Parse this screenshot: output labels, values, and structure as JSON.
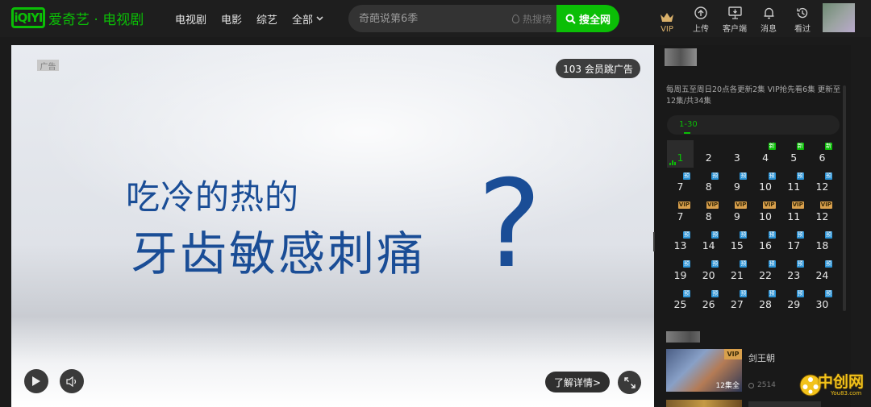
{
  "header": {
    "logo_mark": "iQIYI",
    "logo_text": "爱奇艺 · 电视剧",
    "nav": [
      {
        "label": "电视剧"
      },
      {
        "label": "电影"
      },
      {
        "label": "综艺"
      },
      {
        "label": "全部"
      }
    ],
    "search": {
      "placeholder": "奇葩说第6季",
      "hot_label": "热搜榜",
      "button_label": "搜全网"
    },
    "tools": [
      {
        "label": "VIP",
        "icon": "crown-icon"
      },
      {
        "label": "上传",
        "icon": "upload-icon"
      },
      {
        "label": "客户端",
        "icon": "desktop-icon"
      },
      {
        "label": "消息",
        "icon": "bell-icon"
      },
      {
        "label": "看过",
        "icon": "history-icon"
      }
    ],
    "colors": {
      "brand": "#0bbe06",
      "vip": "#d9b06a"
    }
  },
  "player": {
    "ad_tag": "广告",
    "vip_skip_label": "103 会员跳广告",
    "ad_line1": "吃冷的热的",
    "ad_line2": "牙齿敏感刺痛",
    "ad_qmark": "?",
    "detail_button": "了解详情>",
    "ad_text_color": "#1a4d96"
  },
  "panel": {
    "update_info": "每周五至周日20点各更新2集 VIP抢先看6集 更新至12集/共34集",
    "range_tab": "1-30",
    "episodes": [
      {
        "num": "1",
        "tag": "",
        "active": true
      },
      {
        "num": "2",
        "tag": ""
      },
      {
        "num": "3",
        "tag": ""
      },
      {
        "num": "4",
        "tag": "新"
      },
      {
        "num": "5",
        "tag": "新"
      },
      {
        "num": "6",
        "tag": "新"
      },
      {
        "num": "7",
        "tag": "预"
      },
      {
        "num": "8",
        "tag": "预"
      },
      {
        "num": "9",
        "tag": "预"
      },
      {
        "num": "10",
        "tag": "预"
      },
      {
        "num": "11",
        "tag": "预"
      },
      {
        "num": "12",
        "tag": "预"
      },
      {
        "num": "7",
        "tag": "VIP"
      },
      {
        "num": "8",
        "tag": "VIP"
      },
      {
        "num": "9",
        "tag": "VIP"
      },
      {
        "num": "10",
        "tag": "VIP"
      },
      {
        "num": "11",
        "tag": "VIP"
      },
      {
        "num": "12",
        "tag": "VIP"
      },
      {
        "num": "13",
        "tag": "预"
      },
      {
        "num": "14",
        "tag": "预"
      },
      {
        "num": "15",
        "tag": "预"
      },
      {
        "num": "16",
        "tag": "预"
      },
      {
        "num": "17",
        "tag": "预"
      },
      {
        "num": "18",
        "tag": "预"
      },
      {
        "num": "19",
        "tag": "预"
      },
      {
        "num": "20",
        "tag": "预"
      },
      {
        "num": "21",
        "tag": "预"
      },
      {
        "num": "22",
        "tag": "预"
      },
      {
        "num": "23",
        "tag": "预"
      },
      {
        "num": "24",
        "tag": "预"
      },
      {
        "num": "25",
        "tag": "预"
      },
      {
        "num": "26",
        "tag": "预"
      },
      {
        "num": "27",
        "tag": "预"
      },
      {
        "num": "28",
        "tag": "预"
      },
      {
        "num": "29",
        "tag": "预"
      },
      {
        "num": "30",
        "tag": "预"
      }
    ],
    "recommend": {
      "title": "剑王朝",
      "badge": "VIP",
      "episode_label": "12集全",
      "views": "2514"
    }
  },
  "watermark": {
    "text": "中创网",
    "sub": "You83.com"
  }
}
